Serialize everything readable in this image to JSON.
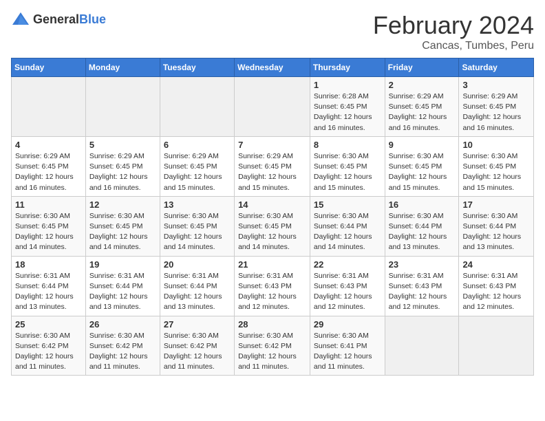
{
  "header": {
    "logo_general": "General",
    "logo_blue": "Blue",
    "month": "February 2024",
    "location": "Cancas, Tumbes, Peru"
  },
  "weekdays": [
    "Sunday",
    "Monday",
    "Tuesday",
    "Wednesday",
    "Thursday",
    "Friday",
    "Saturday"
  ],
  "weeks": [
    [
      {
        "day": "",
        "info": ""
      },
      {
        "day": "",
        "info": ""
      },
      {
        "day": "",
        "info": ""
      },
      {
        "day": "",
        "info": ""
      },
      {
        "day": "1",
        "info": "Sunrise: 6:28 AM\nSunset: 6:45 PM\nDaylight: 12 hours\nand 16 minutes."
      },
      {
        "day": "2",
        "info": "Sunrise: 6:29 AM\nSunset: 6:45 PM\nDaylight: 12 hours\nand 16 minutes."
      },
      {
        "day": "3",
        "info": "Sunrise: 6:29 AM\nSunset: 6:45 PM\nDaylight: 12 hours\nand 16 minutes."
      }
    ],
    [
      {
        "day": "4",
        "info": "Sunrise: 6:29 AM\nSunset: 6:45 PM\nDaylight: 12 hours\nand 16 minutes."
      },
      {
        "day": "5",
        "info": "Sunrise: 6:29 AM\nSunset: 6:45 PM\nDaylight: 12 hours\nand 16 minutes."
      },
      {
        "day": "6",
        "info": "Sunrise: 6:29 AM\nSunset: 6:45 PM\nDaylight: 12 hours\nand 15 minutes."
      },
      {
        "day": "7",
        "info": "Sunrise: 6:29 AM\nSunset: 6:45 PM\nDaylight: 12 hours\nand 15 minutes."
      },
      {
        "day": "8",
        "info": "Sunrise: 6:30 AM\nSunset: 6:45 PM\nDaylight: 12 hours\nand 15 minutes."
      },
      {
        "day": "9",
        "info": "Sunrise: 6:30 AM\nSunset: 6:45 PM\nDaylight: 12 hours\nand 15 minutes."
      },
      {
        "day": "10",
        "info": "Sunrise: 6:30 AM\nSunset: 6:45 PM\nDaylight: 12 hours\nand 15 minutes."
      }
    ],
    [
      {
        "day": "11",
        "info": "Sunrise: 6:30 AM\nSunset: 6:45 PM\nDaylight: 12 hours\nand 14 minutes."
      },
      {
        "day": "12",
        "info": "Sunrise: 6:30 AM\nSunset: 6:45 PM\nDaylight: 12 hours\nand 14 minutes."
      },
      {
        "day": "13",
        "info": "Sunrise: 6:30 AM\nSunset: 6:45 PM\nDaylight: 12 hours\nand 14 minutes."
      },
      {
        "day": "14",
        "info": "Sunrise: 6:30 AM\nSunset: 6:45 PM\nDaylight: 12 hours\nand 14 minutes."
      },
      {
        "day": "15",
        "info": "Sunrise: 6:30 AM\nSunset: 6:44 PM\nDaylight: 12 hours\nand 14 minutes."
      },
      {
        "day": "16",
        "info": "Sunrise: 6:30 AM\nSunset: 6:44 PM\nDaylight: 12 hours\nand 13 minutes."
      },
      {
        "day": "17",
        "info": "Sunrise: 6:30 AM\nSunset: 6:44 PM\nDaylight: 12 hours\nand 13 minutes."
      }
    ],
    [
      {
        "day": "18",
        "info": "Sunrise: 6:31 AM\nSunset: 6:44 PM\nDaylight: 12 hours\nand 13 minutes."
      },
      {
        "day": "19",
        "info": "Sunrise: 6:31 AM\nSunset: 6:44 PM\nDaylight: 12 hours\nand 13 minutes."
      },
      {
        "day": "20",
        "info": "Sunrise: 6:31 AM\nSunset: 6:44 PM\nDaylight: 12 hours\nand 13 minutes."
      },
      {
        "day": "21",
        "info": "Sunrise: 6:31 AM\nSunset: 6:43 PM\nDaylight: 12 hours\nand 12 minutes."
      },
      {
        "day": "22",
        "info": "Sunrise: 6:31 AM\nSunset: 6:43 PM\nDaylight: 12 hours\nand 12 minutes."
      },
      {
        "day": "23",
        "info": "Sunrise: 6:31 AM\nSunset: 6:43 PM\nDaylight: 12 hours\nand 12 minutes."
      },
      {
        "day": "24",
        "info": "Sunrise: 6:31 AM\nSunset: 6:43 PM\nDaylight: 12 hours\nand 12 minutes."
      }
    ],
    [
      {
        "day": "25",
        "info": "Sunrise: 6:30 AM\nSunset: 6:42 PM\nDaylight: 12 hours\nand 11 minutes."
      },
      {
        "day": "26",
        "info": "Sunrise: 6:30 AM\nSunset: 6:42 PM\nDaylight: 12 hours\nand 11 minutes."
      },
      {
        "day": "27",
        "info": "Sunrise: 6:30 AM\nSunset: 6:42 PM\nDaylight: 12 hours\nand 11 minutes."
      },
      {
        "day": "28",
        "info": "Sunrise: 6:30 AM\nSunset: 6:42 PM\nDaylight: 12 hours\nand 11 minutes."
      },
      {
        "day": "29",
        "info": "Sunrise: 6:30 AM\nSunset: 6:41 PM\nDaylight: 12 hours\nand 11 minutes."
      },
      {
        "day": "",
        "info": ""
      },
      {
        "day": "",
        "info": ""
      }
    ]
  ]
}
